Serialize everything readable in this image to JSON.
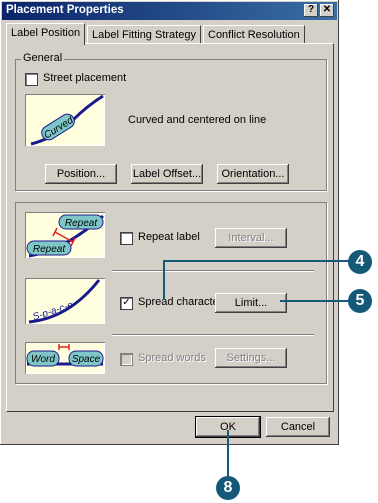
{
  "window": {
    "title": "Placement Properties",
    "help_button": "?",
    "close_button": "✕"
  },
  "tabs": [
    {
      "label": "Label Position"
    },
    {
      "label": "Label Fitting Strategy"
    },
    {
      "label": "Conflict Resolution"
    }
  ],
  "general": {
    "group_label": "General",
    "street_placement_label": "Street placement",
    "street_placement_checked": false,
    "curved_thumb_text": "Curved",
    "description": "Curved and centered on line",
    "position_button": "Position...",
    "label_offset_button": "Label Offset...",
    "orientation_button": "Orientation..."
  },
  "fitting": {
    "repeat_thumb_top": "Repeat",
    "repeat_thumb_bottom": "Repeat",
    "repeat_label": "Repeat label",
    "repeat_checked": false,
    "interval_button": "Interval...",
    "spread_thumb_text": "S-p-a-c-e",
    "spread_chars_label": "Spread characters",
    "spread_chars_checked": true,
    "check_mark": "✓",
    "limit_button": "Limit...",
    "word_thumb_left": "Word",
    "word_thumb_right": "Space",
    "spread_words_label": "Spread words",
    "spread_words_checked": false,
    "settings_button": "Settings..."
  },
  "footer": {
    "ok_button": "OK",
    "cancel_button": "Cancel"
  },
  "callouts": {
    "four": "4",
    "five": "5",
    "eight": "8",
    "color": "#145a78"
  }
}
